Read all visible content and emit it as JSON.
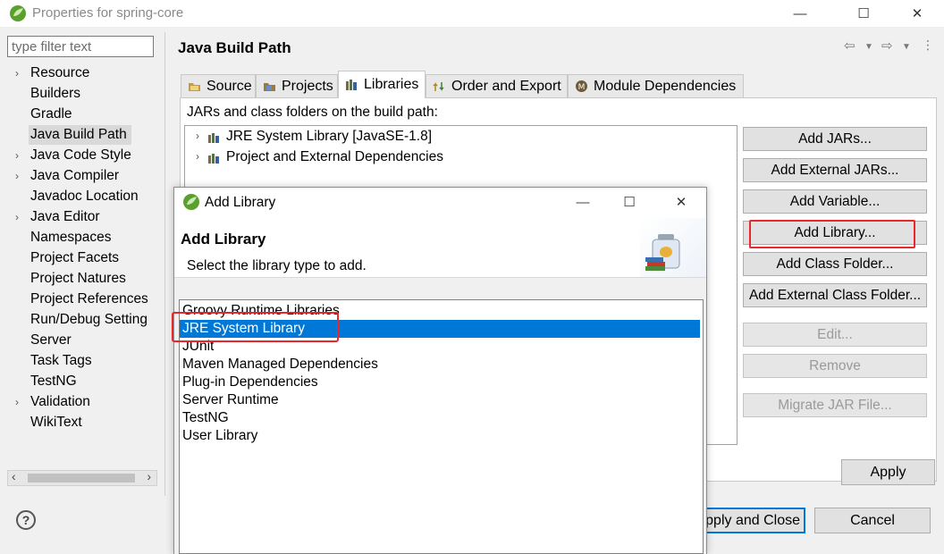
{
  "window": {
    "title": "Properties for spring-core",
    "controls": [
      "—",
      "☐",
      "✕"
    ]
  },
  "nav": {
    "filter_placeholder": "type filter text",
    "items": [
      {
        "label": "Resource",
        "expandable": true
      },
      {
        "label": "Builders",
        "expandable": false
      },
      {
        "label": "Gradle",
        "expandable": false
      },
      {
        "label": "Java Build Path",
        "expandable": false,
        "selected": true
      },
      {
        "label": "Java Code Style",
        "expandable": true
      },
      {
        "label": "Java Compiler",
        "expandable": true
      },
      {
        "label": "Javadoc Location",
        "expandable": false
      },
      {
        "label": "Java Editor",
        "expandable": true
      },
      {
        "label": "Namespaces",
        "expandable": false
      },
      {
        "label": "Project Facets",
        "expandable": false
      },
      {
        "label": "Project Natures",
        "expandable": false
      },
      {
        "label": "Project References",
        "expandable": false
      },
      {
        "label": "Run/Debug Setting",
        "expandable": false
      },
      {
        "label": "Server",
        "expandable": false
      },
      {
        "label": "Task Tags",
        "expandable": false
      },
      {
        "label": "TestNG",
        "expandable": false
      },
      {
        "label": "Validation",
        "expandable": true
      },
      {
        "label": "WikiText",
        "expandable": false
      }
    ]
  },
  "page": {
    "title": "Java Build Path",
    "tabs": [
      {
        "label": "Source",
        "icon": "source-folder-icon"
      },
      {
        "label": "Projects",
        "icon": "projects-icon"
      },
      {
        "label": "Libraries",
        "icon": "libraries-icon",
        "active": true
      },
      {
        "label": "Order and Export",
        "icon": "order-export-icon"
      },
      {
        "label": "Module Dependencies",
        "icon": "module-icon"
      }
    ],
    "jars_label": "JARs and class folders on the build path:",
    "build_path_entries": [
      "JRE System Library [JavaSE-1.8]",
      "Project and External Dependencies"
    ],
    "buttons": {
      "add_jars": "Add JARs...",
      "add_external_jars": "Add External JARs...",
      "add_variable": "Add Variable...",
      "add_library": "Add Library...",
      "add_class_folder": "Add Class Folder...",
      "add_external_class_folder": "Add External Class Folder...",
      "edit": "Edit...",
      "remove": "Remove",
      "migrate_jar": "Migrate JAR File..."
    },
    "apply": "Apply"
  },
  "footer": {
    "help": "?",
    "apply_and_close": "Apply and Close",
    "cancel": "Cancel"
  },
  "dialog": {
    "title": "Add Library",
    "heading": "Add Library",
    "subtitle": "Select the library type to add.",
    "libraries": [
      {
        "label": "Groovy Runtime Libraries"
      },
      {
        "label": "JRE System Library",
        "selected": true
      },
      {
        "label": "JUnit"
      },
      {
        "label": "Maven Managed Dependencies"
      },
      {
        "label": "Plug-in Dependencies"
      },
      {
        "label": "Server Runtime"
      },
      {
        "label": "TestNG"
      },
      {
        "label": "User Library"
      }
    ]
  },
  "colors": {
    "selection": "#0078d7",
    "highlight_box": "#e8262b",
    "eclipse_green": "#5aa02c"
  }
}
